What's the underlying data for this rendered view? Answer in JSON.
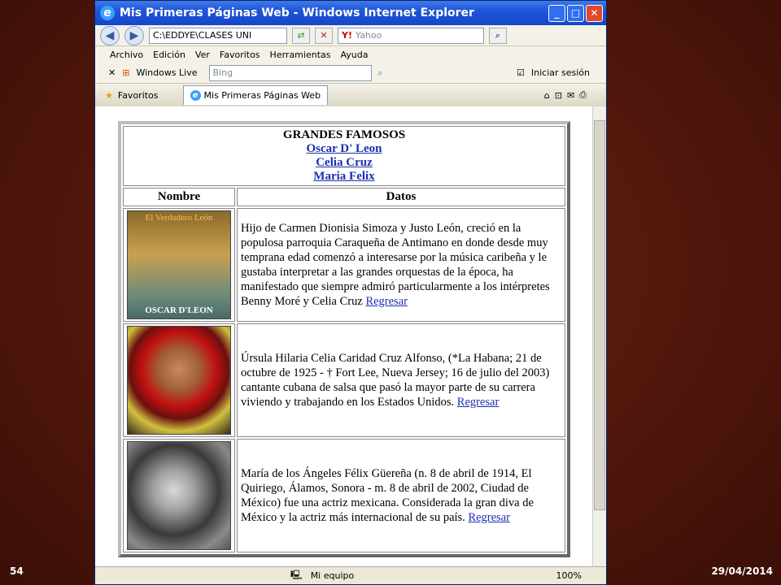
{
  "slide": {
    "number": "54",
    "date": "29/04/2014"
  },
  "window": {
    "title": "Mis Primeras Páginas Web - Windows Internet Explorer",
    "controls": [
      "_",
      "□",
      "✕"
    ]
  },
  "address": {
    "url": "C:\\EDDYE\\CLASES UNI",
    "search_placeholder": "Yahoo",
    "search_provider": "Y!"
  },
  "menu": [
    "Archivo",
    "Edición",
    "Ver",
    "Favoritos",
    "Herramientas",
    "Ayuda"
  ],
  "toolbar": {
    "windows_live": "Windows Live",
    "bing_placeholder": "Bing",
    "signin": "Iniciar sesión"
  },
  "favorites": {
    "label": "Favoritos",
    "tab_title": "Mis Primeras Páginas Web"
  },
  "page": {
    "heading": "GRANDES FAMOSOS",
    "links": [
      "Oscar D' Leon",
      "Celia Cruz",
      "Maria Felix"
    ],
    "col_headers": [
      "Nombre",
      "Datos"
    ],
    "rows": [
      {
        "photo_label": "El Verdadero León",
        "photo_caption": "OSCAR D'LEON",
        "text": "Hijo de Carmen Dionisia Simoza y Justo León, creció en la populosa parroquia Caraqueña de Antimano en donde desde muy temprana edad comenzó a interesarse por la música caribeña y le gustaba interpretar a las grandes orquestas de la época, ha manifestado que siempre admiró particularmente a los intérpretes Benny Moré y Celia Cruz",
        "link": "Regresar"
      },
      {
        "text": "Úrsula Hilaria Celia Caridad Cruz Alfonso, (*La Habana; 21 de octubre de 1925 - † Fort Lee, Nueva Jersey; 16 de julio del 2003) cantante cubana de salsa que pasó la mayor parte de su carrera viviendo y trabajando en los Estados Unidos.",
        "link": "Regresar"
      },
      {
        "text": "María de los Ángeles Félix Güereña (n. 8 de abril de 1914, El Quiriego, Álamos, Sonora - m. 8 de abril de 2002, Ciudad de México) fue una actriz mexicana. Considerada la gran diva de México y la actriz más internacional de su país.",
        "link": "Regresar"
      }
    ]
  },
  "status": {
    "zone": "Mi equipo",
    "zoom": "100%"
  }
}
